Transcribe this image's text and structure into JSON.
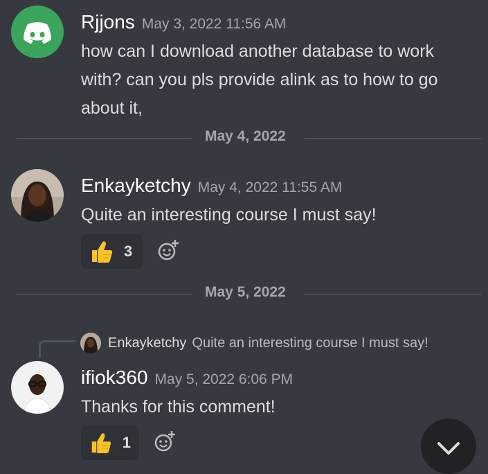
{
  "messages": [
    {
      "username": "Rjjons",
      "timestamp": "May 3, 2022 11:56 AM",
      "content": "how can I download another database to work with? can you pls provide alink as to how to go about it,"
    },
    {
      "username": "Enkayketchy",
      "timestamp": "May 4, 2022 11:55 AM",
      "content": "Quite an interesting course I must say!",
      "reaction": {
        "emoji": "thumbs-up",
        "count": "3"
      }
    },
    {
      "username": "ifiok360",
      "timestamp": "May 5, 2022 6:06 PM",
      "content": "Thanks for this comment!",
      "reaction": {
        "emoji": "thumbs-up",
        "count": "1"
      },
      "reply": {
        "username": "Enkayketchy",
        "content": "Quite an interesting course I must say!"
      }
    }
  ],
  "dividers": [
    "May 4, 2022",
    "May 5, 2022"
  ],
  "colors": {
    "background": "#36393f",
    "discord_avatar": "#3ba55c",
    "reaction_bg": "#2f3136",
    "jump_button": "#202225"
  }
}
